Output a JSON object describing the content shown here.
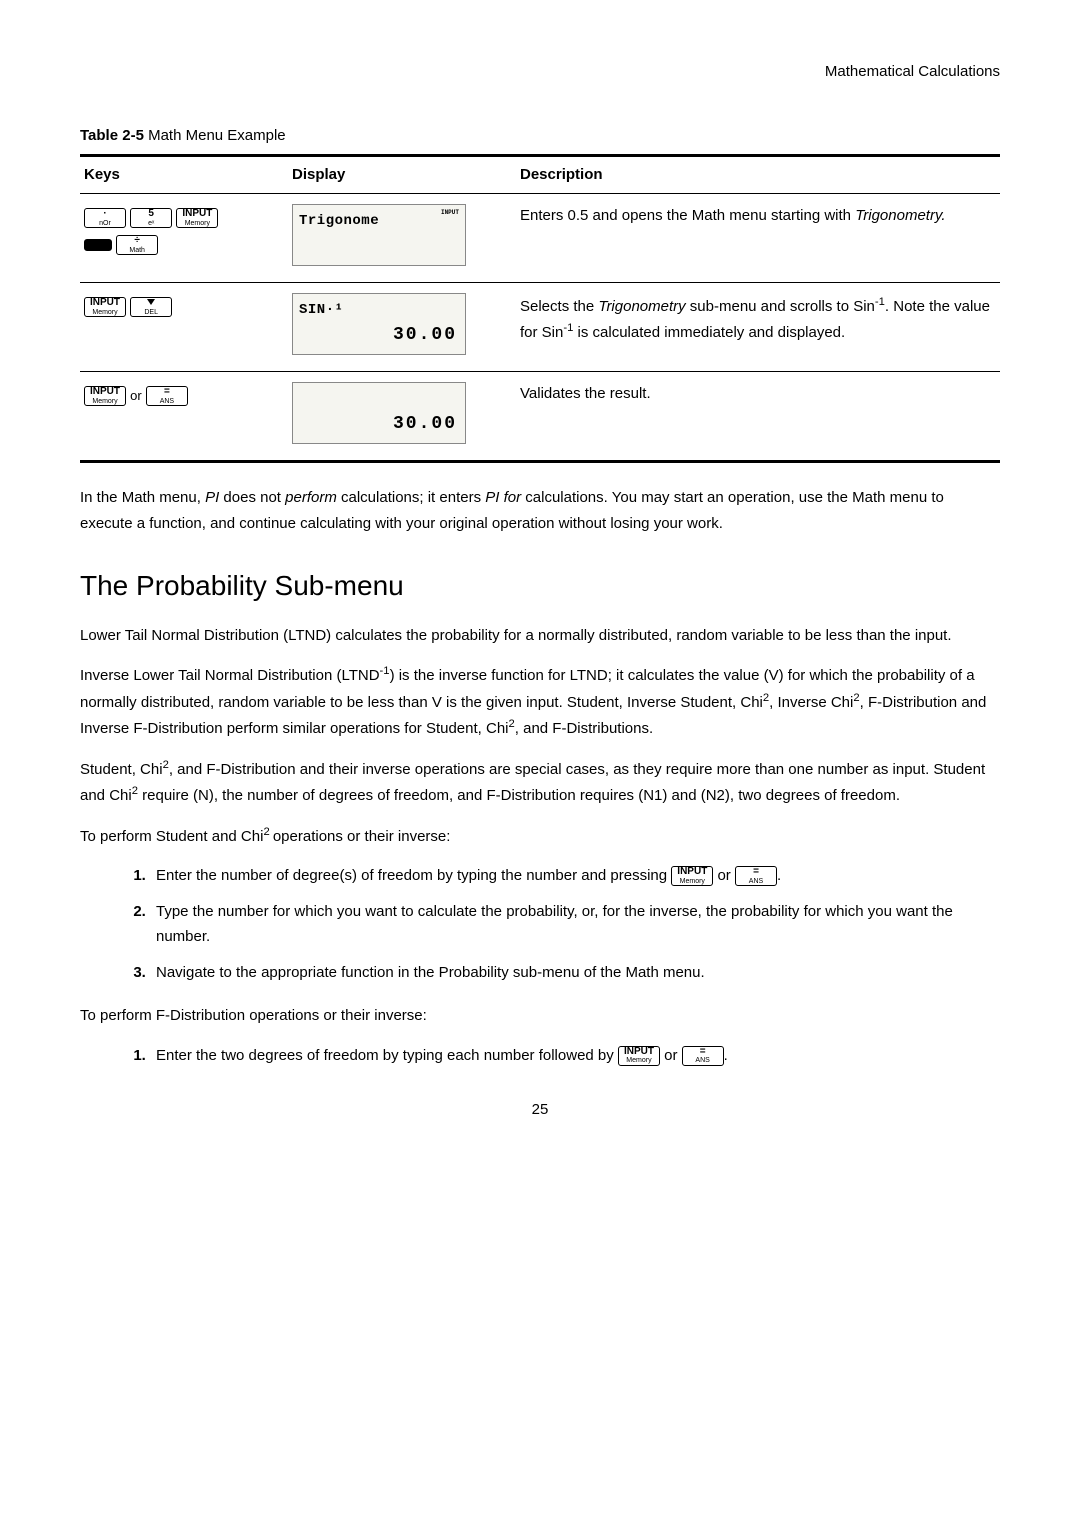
{
  "header": {
    "section": "Mathematical Calculations"
  },
  "table": {
    "caption_bold": "Table 2-5",
    "caption_rest": " Math Menu Example",
    "headers": {
      "keys": "Keys",
      "display": "Display",
      "description": "Description"
    },
    "rows": [
      {
        "keys": {
          "k1": {
            "top": "·",
            "bot": "nOr"
          },
          "k2": {
            "top": "5",
            "bot": "eˣ"
          },
          "k3": {
            "top": "INPUT",
            "bot": "Memory"
          },
          "k4": {
            "top": "÷",
            "bot": "Math"
          }
        },
        "display": {
          "top": "Trigonome",
          "flag": "INPUT",
          "bottom": ""
        },
        "desc_pre": "Enters 0.5 and opens the Math menu starting with ",
        "desc_em": "Trigonometry.",
        "desc_post": ""
      },
      {
        "keys": {
          "k1": {
            "top": "INPUT",
            "bot": "Memory"
          },
          "k2": {
            "top": "▼",
            "bot": "DEL"
          }
        },
        "display": {
          "top": "SIN·¹",
          "flag": "",
          "bottom": "30.00"
        },
        "desc_a": "Selects the ",
        "desc_em": "Trigonometry",
        "desc_b": " sub-menu and scrolls to Sin",
        "desc_c": ". Note the value for Sin",
        "desc_d": " is calculated immediately and displayed."
      },
      {
        "keys": {
          "k1": {
            "top": "INPUT",
            "bot": "Memory"
          },
          "or": "or",
          "k2": {
            "top": "=",
            "bot": "ANS"
          }
        },
        "display": {
          "top": "",
          "flag": "",
          "bottom": "30.00"
        },
        "desc": "Validates the result."
      }
    ]
  },
  "para1_a": "In the Math menu, ",
  "para1_i1": "PI",
  "para1_b": " does not ",
  "para1_i2": "perform",
  "para1_c": " calculations; it enters ",
  "para1_i3": "PI for",
  "para1_d": " calculations. You may start an operation, use the Math menu to execute a function, and continue calculating with your original operation without losing your work.",
  "section_title": "The Probability Sub-menu",
  "para2": "Lower Tail Normal Distribution (LTND) calculates the probability for a normally distributed, random variable to be less than the input.",
  "para3_a": "Inverse Lower Tail Normal Distribution (LTND",
  "para3_b": ") is the inverse function for LTND; it calculates the value (V) for which the probability of a normally distributed, random variable to be less than V is the given input. Student, Inverse Student, Chi",
  "para3_c": ", Inverse Chi",
  "para3_d": ", F-Distribution and Inverse F-Distribution perform similar operations for Student, Chi",
  "para3_e": ", and F-Distributions.",
  "para4_a": "Student, Chi",
  "para4_b": ", and F-Distribution and their inverse operations are special cases, as they require more than one number as input. Student and Chi",
  "para4_c": " require (N), the number of degrees of freedom, and F-Distribution requires (N1) and (N2), two degrees of freedom.",
  "para5_a": "To perform Student and Chi",
  "para5_b": " operations or their inverse:",
  "steps1": {
    "s1_a": "Enter the number of degree(s) of freedom by typing the number and pressing ",
    "s1_or": " or ",
    "s1_end": ".",
    "s2": "Type the number for which you want to calculate the probability, or, for the inverse, the probability for which you want the number.",
    "s3": "Navigate to the appropriate function in the Probability sub-menu of the Math menu."
  },
  "para6": "To perform F-Distribution operations or their inverse:",
  "steps2": {
    "s1_a": "Enter the two degrees of freedom by typing each number followed by ",
    "s1_or": " or ",
    "s1_end": "."
  },
  "inline_keys": {
    "input": {
      "top": "INPUT",
      "bot": "Memory"
    },
    "equals": {
      "top": "=",
      "bot": "ANS"
    }
  },
  "page": "25"
}
